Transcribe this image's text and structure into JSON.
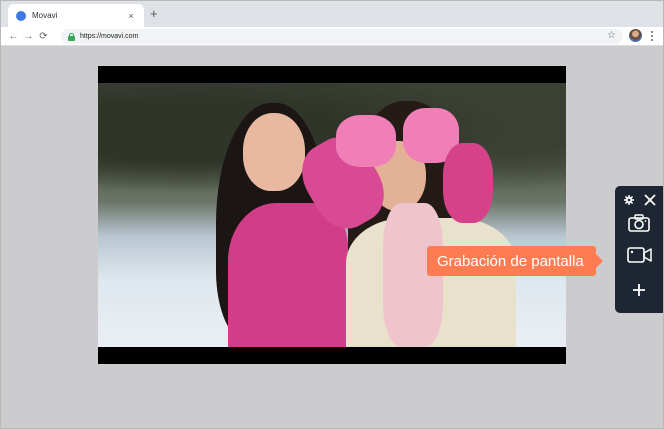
{
  "browser": {
    "tab": {
      "title": "Movavi",
      "favicon": "movavi-icon",
      "close": "×"
    },
    "new_tab": "+",
    "toolbar": {
      "back": "←",
      "forward": "→",
      "reload": "⟳",
      "url": "https://movavi.com",
      "star": "☆"
    }
  },
  "recorder_panel": {
    "buttons": [
      "gear-icon",
      "close-icon",
      "camera-icon",
      "video-camera-icon",
      "plus-icon"
    ],
    "tooltip": "Grabación de pantalla"
  },
  "colors": {
    "panel_bg": "#1f2633",
    "tooltip_bg": "#ff7b52",
    "page_bg": "#ccccce",
    "tab_strip": "#dee1e6"
  }
}
